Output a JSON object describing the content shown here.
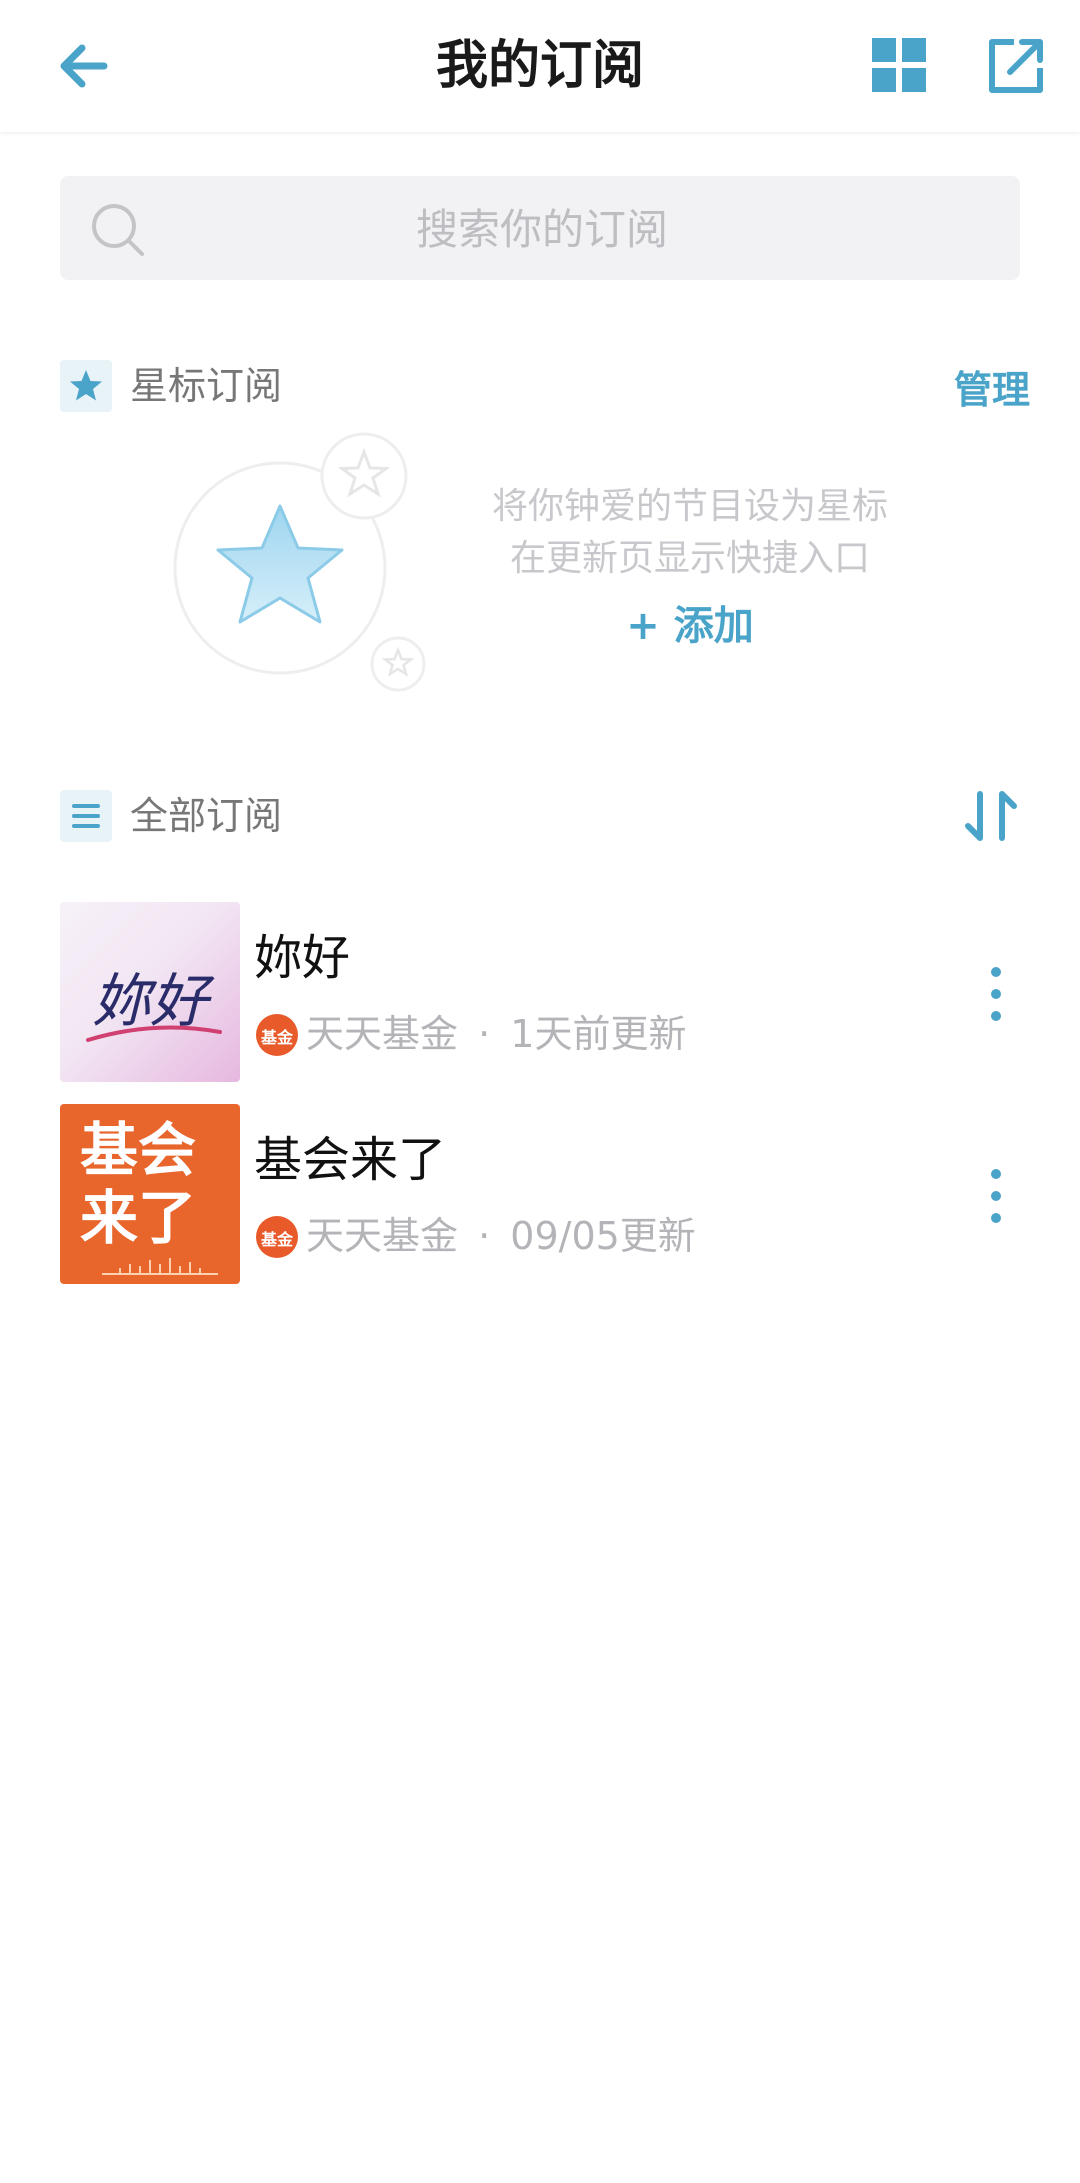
{
  "header": {
    "title": "我的订阅"
  },
  "search": {
    "placeholder": "搜索你的订阅"
  },
  "starred": {
    "label": "星标订阅",
    "manage_label": "管理",
    "empty_line1": "将你钟爱的节目设为星标",
    "empty_line2": "在更新页显示快捷入口",
    "add_label": "+ 添加"
  },
  "all": {
    "label": "全部订阅",
    "items": [
      {
        "title": "妳好",
        "cover_text": "妳好",
        "publisher": "天天基金",
        "publisher_logo": "基金",
        "separator": "·",
        "updated": "1天前更新"
      },
      {
        "title": "基会来了",
        "cover_text": "基会来了",
        "publisher": "天天基金",
        "publisher_logo": "基金",
        "separator": "·",
        "updated": "09/05更新"
      }
    ]
  },
  "colors": {
    "accent": "#4aa3c8",
    "cover_orange": "#e8652c"
  }
}
